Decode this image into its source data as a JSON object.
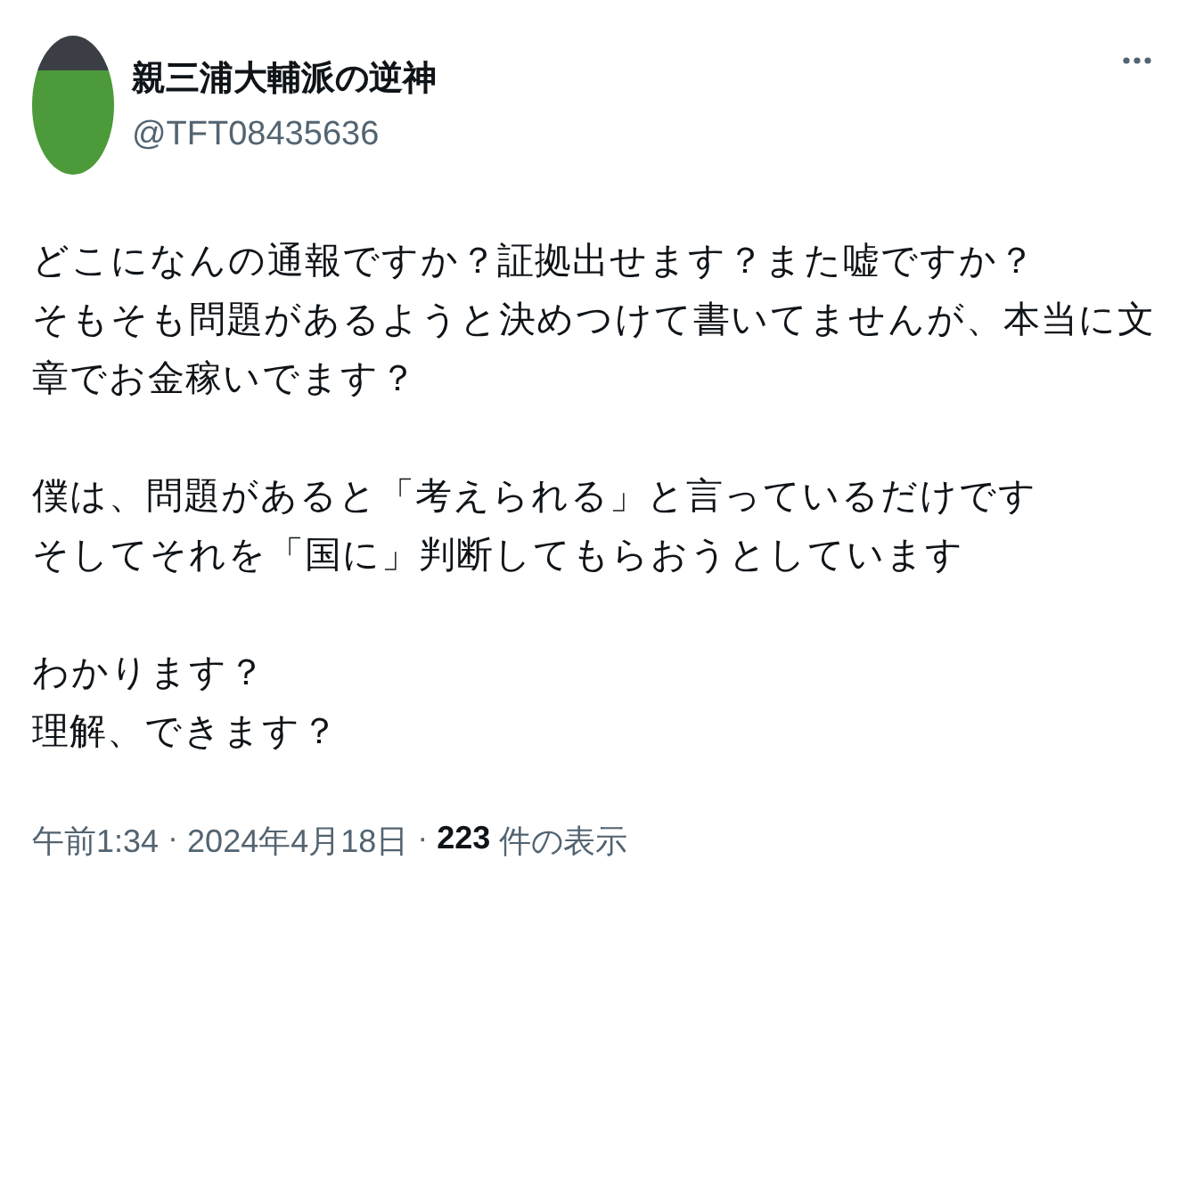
{
  "author": {
    "name": "親三浦大輔派の逆神",
    "handle": "@TFT08435636"
  },
  "body": [
    [
      "どこになんの通報ですか？証拠出せます？また嘘ですか？",
      "そもそも問題があるようと決めつけて書いてませんが、本当に文章でお金稼いでます？"
    ],
    [
      "僕は、問題があると「考えられる」と言っているだけです",
      "そしてそれを「国に」判断してもらおうとしています"
    ],
    [
      "わかります？",
      "理解、できます？"
    ]
  ],
  "meta": {
    "time": "午前1:34",
    "separator": "·",
    "date": "2024年4月18日",
    "views": "223",
    "views_label": "件の表示"
  }
}
